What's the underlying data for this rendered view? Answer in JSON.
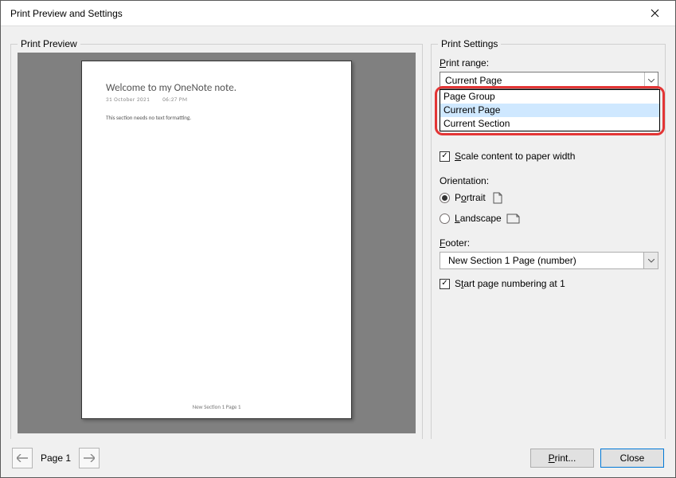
{
  "window": {
    "title": "Print Preview and Settings"
  },
  "preview": {
    "legend": "Print Preview",
    "page": {
      "title": "Welcome to my OneNote note.",
      "date": "31 October 2021",
      "time": "06:27 PM",
      "body": "This section needs no text formatting.",
      "footer": "New Section 1 Page 1"
    }
  },
  "settings": {
    "legend": "Print Settings",
    "range_label": "Print range:",
    "range_selected": "Current Page",
    "range_options": [
      "Page Group",
      "Current Page",
      "Current Section"
    ],
    "scale_label": "Scale content to paper width",
    "scale_checked": true,
    "orientation_label": "Orientation:",
    "orientation_portrait": "Portrait",
    "orientation_landscape": "Landscape",
    "orientation_value": "Portrait",
    "footer_label": "Footer:",
    "footer_value": "New Section 1 Page (number)",
    "startnum_label": "Start page numbering at 1",
    "startnum_checked": true
  },
  "nav": {
    "page_label": "Page 1"
  },
  "buttons": {
    "print": "Print...",
    "close": "Close"
  }
}
